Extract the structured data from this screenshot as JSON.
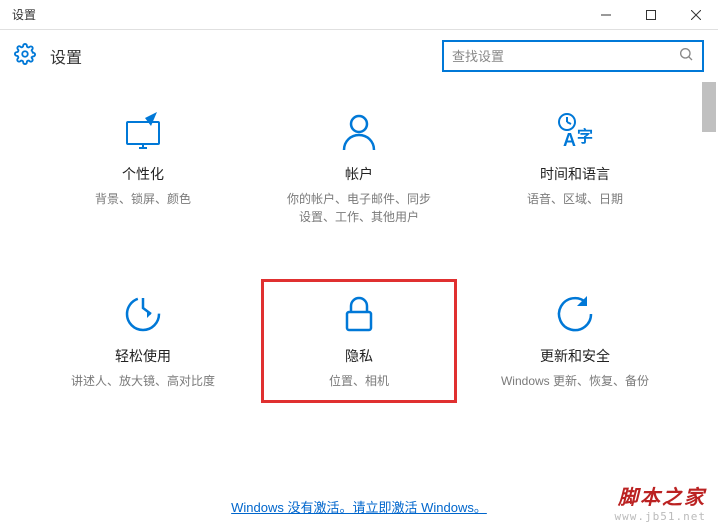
{
  "window": {
    "title": "设置"
  },
  "header": {
    "title": "设置"
  },
  "search": {
    "placeholder": "查找设置"
  },
  "tiles": [
    {
      "label": "个性化",
      "desc": "背景、锁屏、颜色"
    },
    {
      "label": "帐户",
      "desc": "你的帐户、电子邮件、同步设置、工作、其他用户"
    },
    {
      "label": "时间和语言",
      "desc": "语音、区域、日期"
    },
    {
      "label": "轻松使用",
      "desc": "讲述人、放大镜、高对比度"
    },
    {
      "label": "隐私",
      "desc": "位置、相机"
    },
    {
      "label": "更新和安全",
      "desc": "Windows 更新、恢复、备份"
    }
  ],
  "activation": {
    "text": "Windows 没有激活。请立即激活 Windows。"
  },
  "watermark": {
    "brand": "脚本之家",
    "url": "www.jb51.net"
  }
}
